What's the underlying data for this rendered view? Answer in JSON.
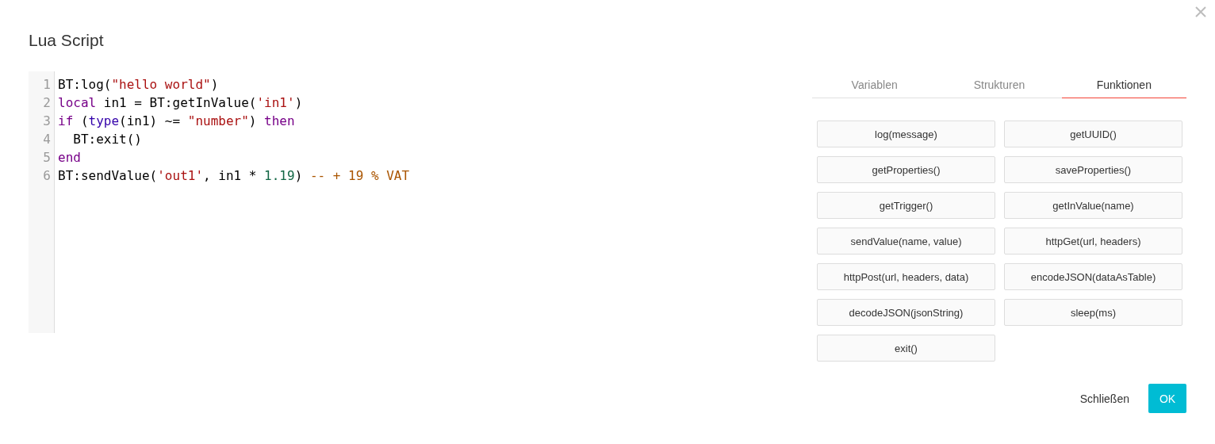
{
  "dialog": {
    "title": "Lua Script"
  },
  "editor": {
    "lines": [
      {
        "number": "1",
        "tokens": [
          {
            "kind": "plain",
            "text": "BT:log("
          },
          {
            "kind": "string",
            "text": "\"hello world\""
          },
          {
            "kind": "plain",
            "text": ")"
          }
        ]
      },
      {
        "number": "2",
        "tokens": [
          {
            "kind": "keyword",
            "text": "local"
          },
          {
            "kind": "plain",
            "text": " in1 = BT:getInValue("
          },
          {
            "kind": "string",
            "text": "'in1'"
          },
          {
            "kind": "plain",
            "text": ")"
          }
        ]
      },
      {
        "number": "3",
        "tokens": [
          {
            "kind": "keyword",
            "text": "if"
          },
          {
            "kind": "plain",
            "text": " ("
          },
          {
            "kind": "builtin",
            "text": "type"
          },
          {
            "kind": "plain",
            "text": "(in1) ~= "
          },
          {
            "kind": "string",
            "text": "\"number\""
          },
          {
            "kind": "plain",
            "text": ") "
          },
          {
            "kind": "keyword",
            "text": "then"
          }
        ]
      },
      {
        "number": "4",
        "tokens": [
          {
            "kind": "plain",
            "text": "  BT:exit()"
          }
        ]
      },
      {
        "number": "5",
        "tokens": [
          {
            "kind": "keyword",
            "text": "end"
          }
        ]
      },
      {
        "number": "6",
        "tokens": [
          {
            "kind": "plain",
            "text": "BT:sendValue("
          },
          {
            "kind": "string",
            "text": "'out1'"
          },
          {
            "kind": "plain",
            "text": ", in1 * "
          },
          {
            "kind": "number",
            "text": "1.19"
          },
          {
            "kind": "plain",
            "text": ") "
          },
          {
            "kind": "comment",
            "text": "-- + 19 % VAT"
          }
        ]
      }
    ]
  },
  "tabs": [
    {
      "label": "Variablen",
      "selected": false
    },
    {
      "label": "Strukturen",
      "selected": false
    },
    {
      "label": "Funktionen",
      "selected": true
    }
  ],
  "functions": [
    "log(message)",
    "getUUID()",
    "getProperties()",
    "saveProperties()",
    "getTrigger()",
    "getInValue(name)",
    "sendValue(name, value)",
    "httpGet(url, headers)",
    "httpPost(url, headers, data)",
    "encodeJSON(dataAsTable)",
    "decodeJSON(jsonString)",
    "sleep(ms)",
    "exit()"
  ],
  "buttons": {
    "close": "Schließen",
    "ok": "OK"
  }
}
